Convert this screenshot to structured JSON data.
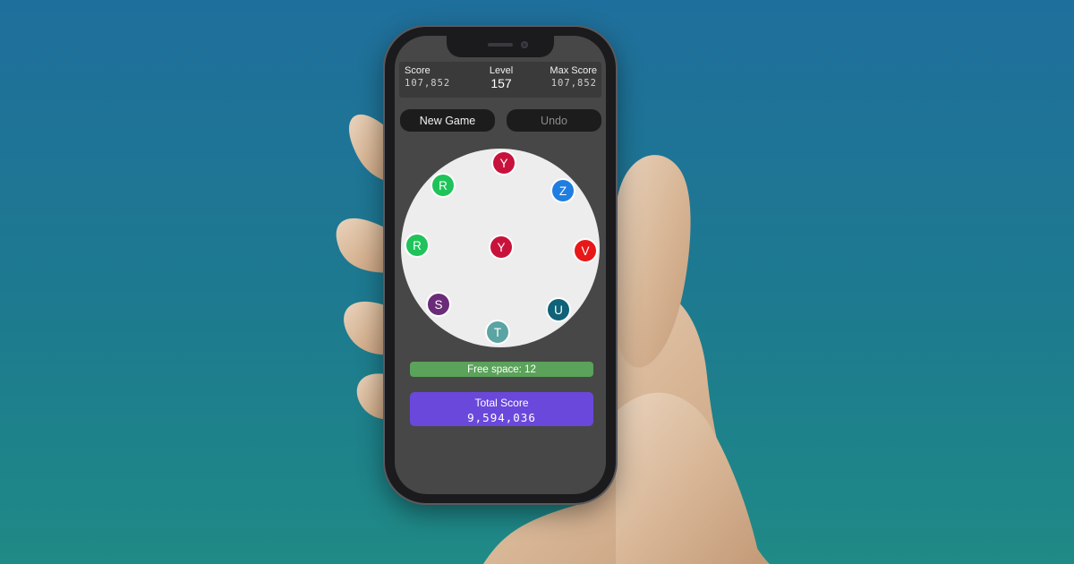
{
  "scorebar": {
    "score_label": "Score",
    "score_value": "107,852",
    "level_label": "Level",
    "level_value": "157",
    "max_label": "Max Score",
    "max_value": "107,852"
  },
  "controls": {
    "new_game_label": "New Game",
    "undo_label": "Undo"
  },
  "board": {
    "balls": [
      {
        "letter": "Y",
        "color": "#c8123c"
      },
      {
        "letter": "Z",
        "color": "#1f7ee0"
      },
      {
        "letter": "V",
        "color": "#e81818"
      },
      {
        "letter": "U",
        "color": "#0f6277"
      },
      {
        "letter": "T",
        "color": "#5aa4a3"
      },
      {
        "letter": "S",
        "color": "#6a2c79"
      },
      {
        "letter": "R",
        "color": "#1fc35a"
      },
      {
        "letter": "R",
        "color": "#1fc35a"
      },
      {
        "letter": "Y",
        "color": "#c8123c"
      }
    ]
  },
  "free_space_text": "Free space: 12",
  "total": {
    "label": "Total Score",
    "value": "9,594,036"
  }
}
